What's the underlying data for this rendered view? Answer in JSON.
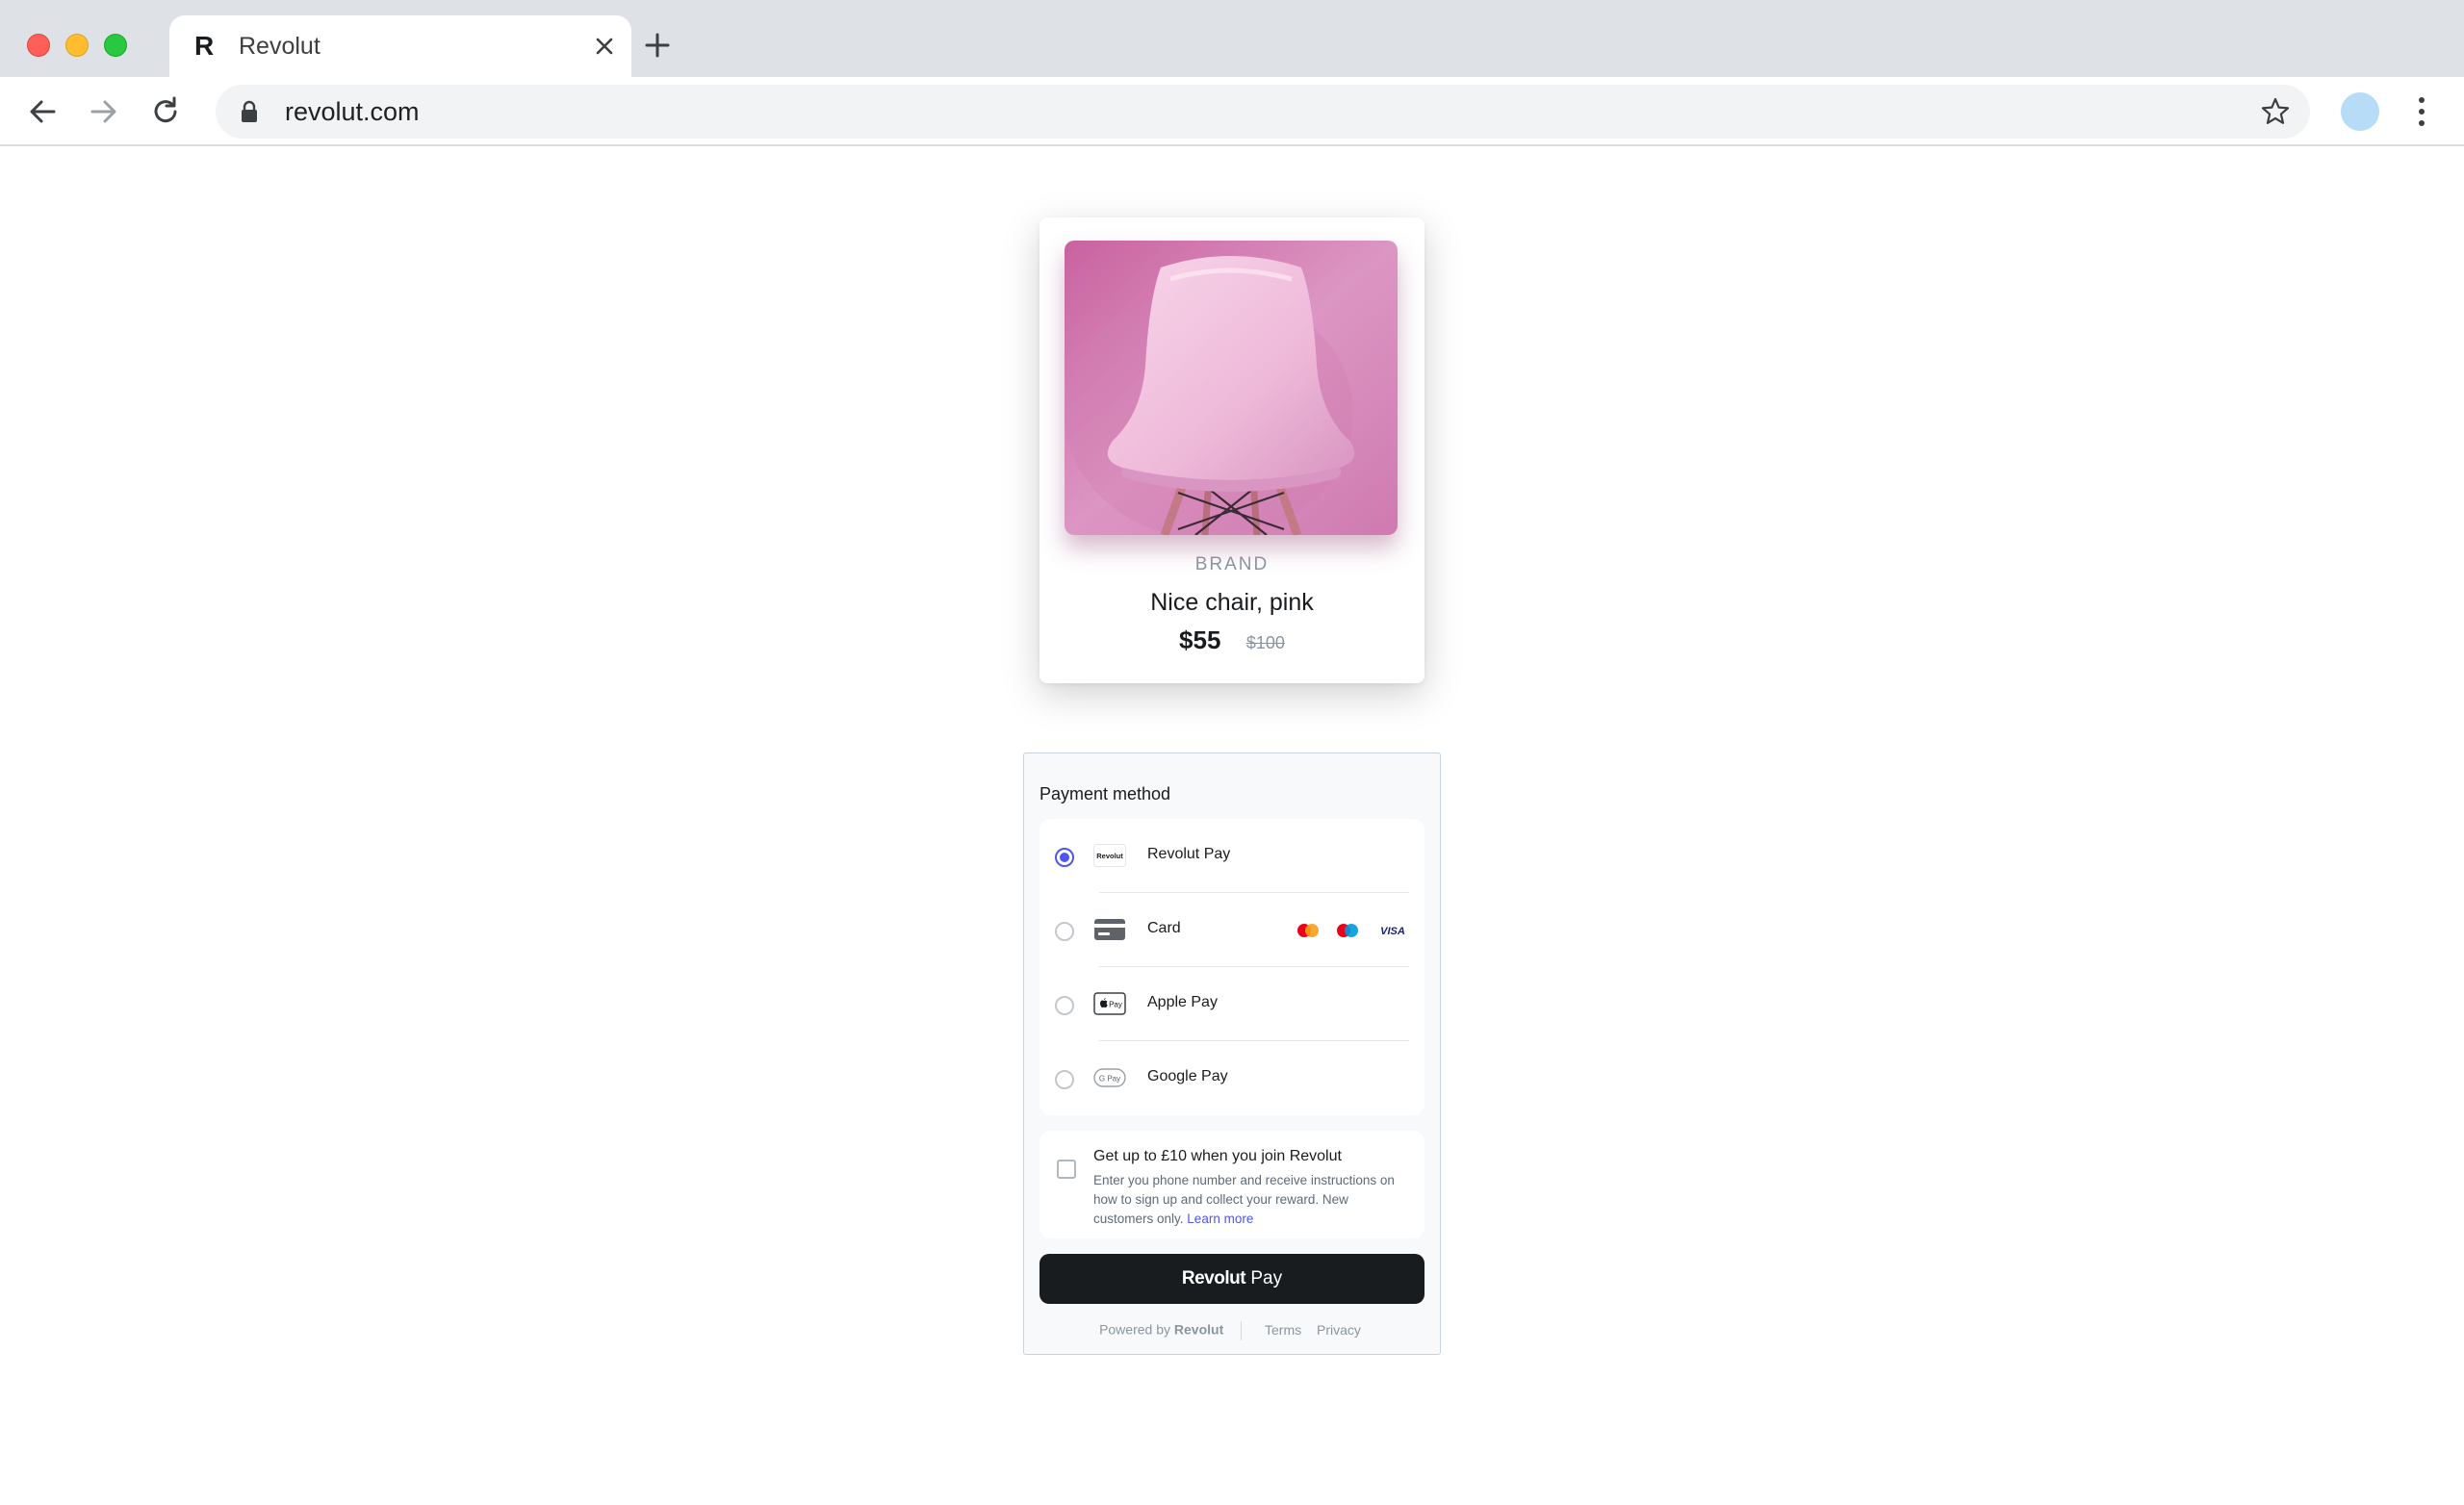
{
  "browser": {
    "tab_title": "Revolut",
    "favicon_letter": "R",
    "url": "revolut.com"
  },
  "product": {
    "brand": "BRAND",
    "name": "Nice chair, pink",
    "price": "$55",
    "old_price": "$100",
    "image_colors": {
      "background": "#d98fbe",
      "chair": "#f3c6e1"
    }
  },
  "payment": {
    "title": "Payment method",
    "methods": [
      {
        "label": "Revolut Pay",
        "icon": "revolut-logo-icon",
        "icon_text": "Revolut",
        "selected": true
      },
      {
        "label": "Card",
        "icon": "credit-card-icon",
        "selected": false,
        "card_brands": [
          "mastercard",
          "maestro",
          "VISA"
        ]
      },
      {
        "label": "Apple Pay",
        "icon": "apple-pay-icon",
        "icon_text": "Pay",
        "selected": false
      },
      {
        "label": "Google Pay",
        "icon": "google-pay-icon",
        "icon_text": "G Pay",
        "selected": false
      }
    ],
    "promo": {
      "title": "Get up to £10 when you join Revolut",
      "text": "Enter you phone number and receive instructions on how to sign up and collect your reward. New customers only.",
      "link": "Learn more",
      "checked": false
    },
    "button": {
      "brand": "Revolut",
      "suffix": " Pay"
    },
    "footer": {
      "powered_by": "Powered by",
      "powered_brand": "Revolut",
      "terms": "Terms",
      "privacy": "Privacy"
    },
    "accent_color": "#4f55f1"
  }
}
